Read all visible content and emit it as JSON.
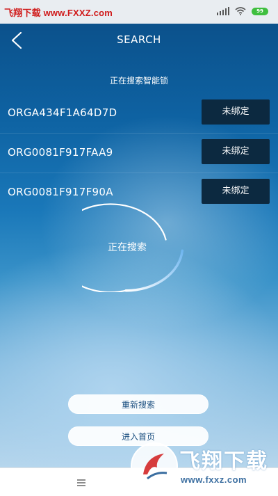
{
  "status_bar": {
    "watermark_text": "飞翔下载 www.FXXZ.com",
    "battery_level": "99"
  },
  "nav": {
    "back_icon": "chevron-left-icon",
    "title": "SEARCH"
  },
  "searching_label": "正在搜索智能锁",
  "devices": [
    {
      "id": "ORGA434F1A64D7D",
      "action": "未绑定"
    },
    {
      "id": "ORG0081F917FAA9",
      "action": "未绑定"
    },
    {
      "id": "ORG0081F917F90A",
      "action": "未绑定"
    }
  ],
  "spinner": {
    "label": "正在搜索"
  },
  "buttons": {
    "rescan": "重新搜索",
    "home": "进入首页"
  },
  "bottom_bar": {
    "menu_icon": "menu-icon"
  },
  "watermark": {
    "cn": "飞翔下载",
    "url": "www.fxxz.com"
  },
  "colors": {
    "accent": "#0e62a2",
    "button_dark": "#0c2940",
    "watermark_red": "#d01b1b"
  }
}
